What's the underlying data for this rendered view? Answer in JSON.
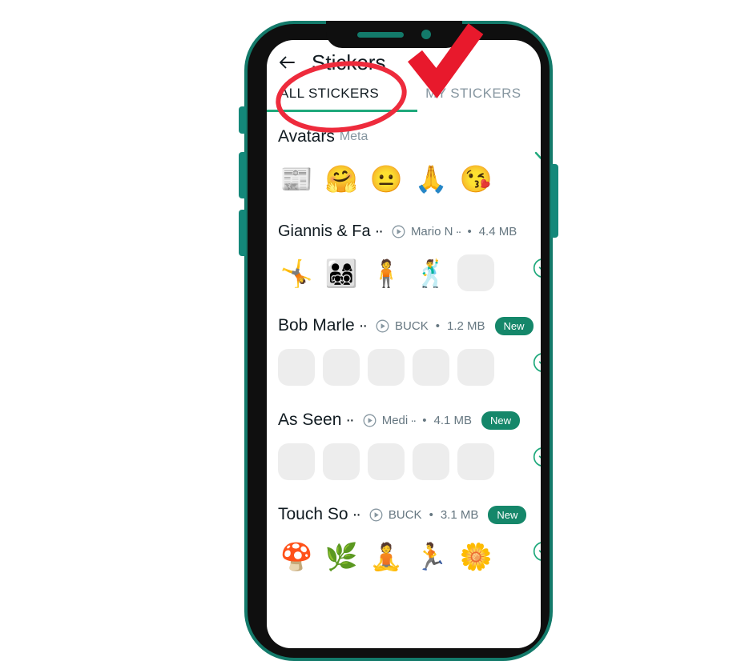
{
  "app": {
    "title": "Stickers",
    "back_icon": "back-arrow-icon"
  },
  "tabs": [
    {
      "label": "ALL STICKERS",
      "active": true
    },
    {
      "label": "MY STICKERS",
      "active": false
    }
  ],
  "packs": [
    {
      "name": "Avatars",
      "publisher_tag": "Meta",
      "truncated": false,
      "animated": false,
      "author": "",
      "size": "",
      "badge": "",
      "action": "check",
      "stickers": [
        "📰",
        "🤗",
        "😐",
        "🙏",
        "😘"
      ],
      "placeholders": 0
    },
    {
      "name": "Giannis & Fa",
      "publisher_tag": "",
      "truncated": true,
      "animated": true,
      "author": "Mario N",
      "author_truncated": true,
      "size": "4.4 MB",
      "badge": "",
      "action": "download",
      "stickers": [
        "🤸",
        "👨‍👩‍👧‍👦",
        "🧍",
        "🕺"
      ],
      "placeholders": 1
    },
    {
      "name": "Bob Marle",
      "publisher_tag": "",
      "truncated": true,
      "animated": true,
      "author": "BUCK",
      "author_truncated": false,
      "size": "1.2 MB",
      "badge": "New",
      "action": "download",
      "stickers": [],
      "placeholders": 5
    },
    {
      "name": "As Seen",
      "publisher_tag": "",
      "truncated": true,
      "animated": true,
      "author": "Medi",
      "author_truncated": true,
      "size": "4.1 MB",
      "badge": "New",
      "action": "download",
      "stickers": [],
      "placeholders": 5
    },
    {
      "name": "Touch So",
      "publisher_tag": "",
      "truncated": true,
      "animated": true,
      "author": "BUCK",
      "author_truncated": false,
      "size": "3.1 MB",
      "badge": "New",
      "action": "download",
      "stickers": [
        "🍄",
        "🌿",
        "🧘",
        "🏃",
        "🌼"
      ],
      "placeholders": 0
    }
  ],
  "annotations": {
    "circle_color": "#ee2b3c",
    "check_color": "#e8192c",
    "circle_target": "ALL STICKERS",
    "check_target": "MY STICKERS"
  },
  "colors": {
    "accent_green": "#1fa97c",
    "badge_green": "#15876a",
    "frame_teal": "#137a6a",
    "text_primary": "#111b21",
    "text_secondary": "#667781",
    "text_muted": "#8696a0",
    "placeholder_gray": "#ededed"
  }
}
